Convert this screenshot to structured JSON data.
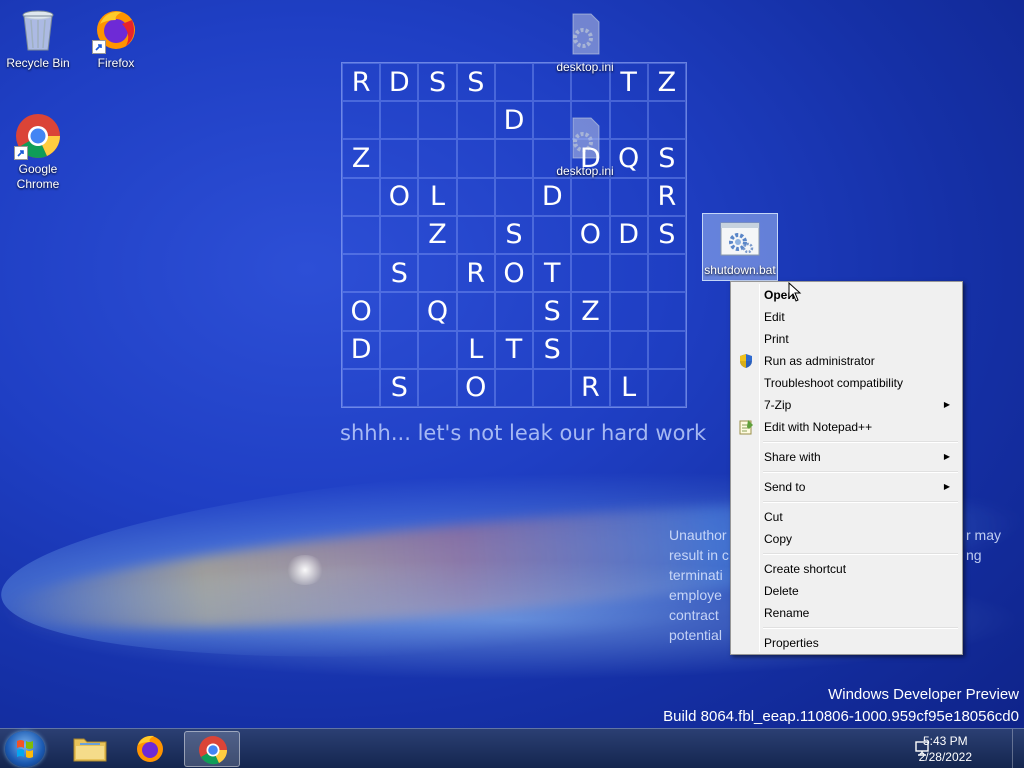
{
  "desktop": {
    "icons": [
      {
        "label": "Recycle Bin"
      },
      {
        "label": "Firefox"
      },
      {
        "label": "Google Chrome"
      },
      {
        "label": "desktop.ini"
      },
      {
        "label": "desktop.ini"
      },
      {
        "label": "shutdown.bat"
      }
    ]
  },
  "puzzle": {
    "rows": [
      [
        "R",
        "D",
        "S",
        "S",
        "",
        "",
        "",
        "T",
        "Z"
      ],
      [
        "",
        "",
        "",
        "",
        "D",
        "",
        "",
        "",
        ""
      ],
      [
        "Z",
        "",
        "",
        "",
        "",
        "",
        "D",
        "Q",
        "S"
      ],
      [
        "",
        "O",
        "L",
        "",
        "",
        "D",
        "",
        "",
        "R"
      ],
      [
        "",
        "",
        "Z",
        "",
        "S",
        "",
        "O",
        "D",
        "S"
      ],
      [
        "",
        "S",
        "",
        "R",
        "O",
        "T",
        "",
        "",
        ""
      ],
      [
        "O",
        "",
        "Q",
        "",
        "",
        "S",
        "Z",
        "",
        ""
      ],
      [
        "D",
        "",
        "",
        "L",
        "T",
        "S",
        "",
        "",
        ""
      ],
      [
        "",
        "S",
        "",
        "O",
        "",
        "",
        "R",
        "L",
        ""
      ]
    ],
    "tagline": "shhh... let's not leak our hard work"
  },
  "notice_lines": [
    "Unauthor",
    "result in c",
    "terminati",
    "employe",
    "contract",
    "potential"
  ],
  "notice_right": [
    "r may",
    "ng"
  ],
  "watermark": {
    "line1": "Windows Developer Preview",
    "line2": "Build 8064.fbl_eeap.110806-1000.959cf95e18056cd0"
  },
  "context_menu": {
    "open": "Open",
    "edit": "Edit",
    "print": "Print",
    "run_admin": "Run as administrator",
    "troubleshoot": "Troubleshoot compatibility",
    "sevenzip": "7-Zip",
    "notepadpp": "Edit with Notepad++",
    "share_with": "Share with",
    "send_to": "Send to",
    "cut": "Cut",
    "copy": "Copy",
    "create_shortcut": "Create shortcut",
    "delete": "Delete",
    "rename": "Rename",
    "properties": "Properties"
  },
  "taskbar": {
    "time": "5:43 PM",
    "date": "2/28/2022",
    "pinned": [
      "file-explorer",
      "firefox",
      "chrome"
    ]
  },
  "colors": {
    "desktop_blue": "#1f3fc4",
    "menu_bg": "#f0f0f0",
    "taskbar": "#1a2c5a"
  }
}
